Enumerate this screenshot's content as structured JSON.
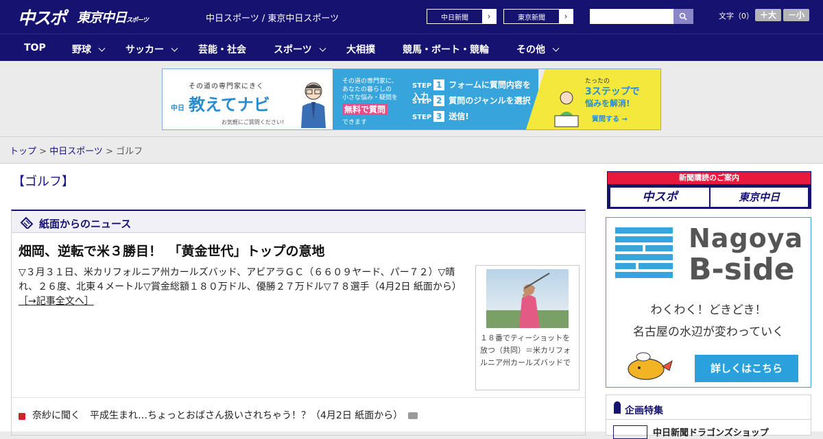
{
  "header": {
    "logo_main": "中スポ",
    "logo_tokyo": "東京中日",
    "logo_tokyo_small": "スポーツ",
    "site_names": "中日スポーツ / 東京中日スポーツ",
    "site_link_1": "中日新聞",
    "site_link_2": "東京新聞",
    "arrow": "›",
    "font_label": "文字（0）",
    "font_bigger": "＋大",
    "font_smaller": "－小"
  },
  "nav": {
    "items": [
      {
        "label": "TOP"
      },
      {
        "label": "野球"
      },
      {
        "label": "サッカー"
      },
      {
        "label": "芸能・社会"
      },
      {
        "label": "スポーツ"
      },
      {
        "label": "大相撲"
      },
      {
        "label": "競馬・ボート・競輪"
      },
      {
        "label": "その他"
      }
    ]
  },
  "ad": {
    "tagline": "その道の専門家にきく",
    "brand_prefix": "中日",
    "brand": "教えてナビ",
    "note": "お気軽にご質問ください!",
    "desc_1": "その道の専門家に、",
    "desc_2": "あなたの暮らしの",
    "desc_3": "小さな悩み・疑問を",
    "highlight": "無料で質問",
    "desc_4": "できます",
    "step_word": "STEP",
    "steps": [
      {
        "num": "1",
        "text": "フォームに質問内容を入力"
      },
      {
        "num": "2",
        "text": "質問のジャンルを選択"
      },
      {
        "num": "3",
        "text": "送信!"
      }
    ],
    "c1": "たったの",
    "c2": "3ステップで",
    "c3": "悩みを解消!",
    "c4": "質問する →"
  },
  "breadcrumb": {
    "top": "トップ",
    "sep": " > ",
    "section": "中日スポーツ",
    "current": "ゴルフ"
  },
  "page": {
    "title": "【ゴルフ】"
  },
  "news": {
    "header": "紙面からのニュース",
    "headline": "畑岡、逆転で米３勝目！　「黄金世代」トップの意地",
    "body": "▽３月３１日、米カリフォルニア州カールズバッド、アビアラＧＣ（６６０９ヤード、パー７２）▽晴れ、２６度、北東４メートル▽賞金総額１８０万ドル、優勝２７万ドル▽７８選手（4月2日 紙面から）",
    "more_link": "［→記事全文へ］",
    "photo_caption": "１８番でティーショットを放つ（共同）＝米カリフォルニア州カールズバッドで",
    "list": [
      {
        "text": "奈紗に聞く　平成生まれ…ちょっとおばさん扱いされちゃう！？（4月2日 紙面から）"
      }
    ]
  },
  "sidebar": {
    "subscribe_title": "新聞購読のご案内",
    "subscribe_1": "中スポ",
    "subscribe_2": "東京中日",
    "nb_title_1": "Nagoya",
    "nb_title_2": "B-side",
    "nb_sub_1": "わくわく！どきどき！",
    "nb_sub_2": "名古屋の水辺が変わっていく",
    "nb_button": "詳しくはこちら",
    "feature_title": "企画特集",
    "feature_item": "中日新聞ドラゴンズショップ"
  }
}
